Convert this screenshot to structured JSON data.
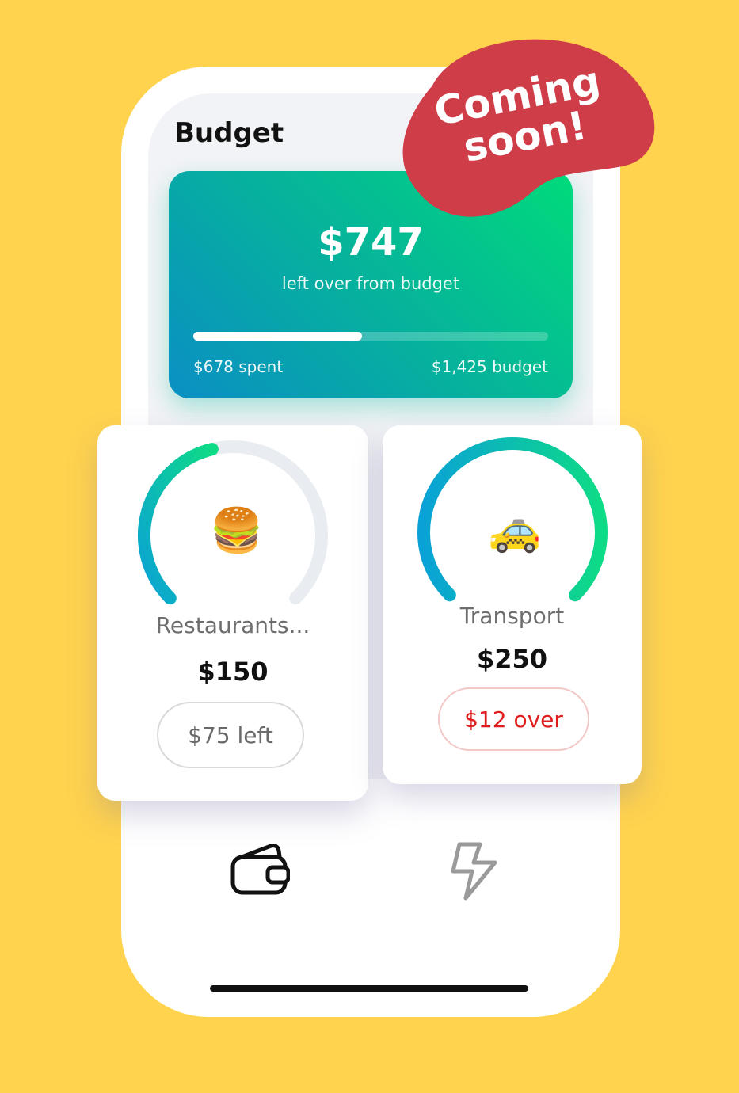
{
  "screen": {
    "title": "Budget"
  },
  "budget_card": {
    "amount": "$747",
    "subtitle": "left over from budget",
    "spent_label": "$678 spent",
    "budget_label": "$1,425 budget",
    "progress_fraction": 0.476,
    "gradient_colors": [
      "#00DB7B",
      "#0A8FC4"
    ]
  },
  "categories": [
    {
      "emoji": "🍔",
      "emoji_name": "hamburger-icon",
      "name": "Restaurants...",
      "amount": "$150",
      "status": "$75 left",
      "status_type": "left",
      "gauge_fraction": 0.45
    },
    {
      "emoji": "🚕",
      "emoji_name": "taxi-icon",
      "name": "Transport",
      "amount": "$250",
      "status": "$12 over",
      "status_type": "over",
      "gauge_fraction": 1.0
    }
  ],
  "nav": {
    "items": [
      {
        "icon": "wallet-icon",
        "active": true
      },
      {
        "icon": "lightning-icon",
        "active": false
      }
    ]
  },
  "badge": {
    "line1": "Coming",
    "line2": "soon!",
    "color": "#CF3D49"
  },
  "colors": {
    "background": "#FFD34E",
    "gauge_start": "#0AA2D6",
    "gauge_end": "#0EDB86",
    "gauge_track": "#E9ECF1",
    "over_text": "#E01B1B"
  }
}
